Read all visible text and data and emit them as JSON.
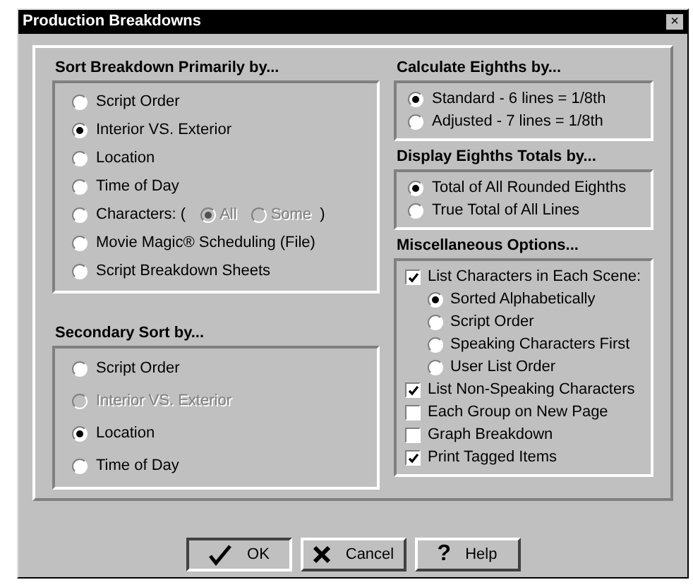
{
  "window": {
    "title": "Production Breakdowns",
    "close": "×"
  },
  "primary_sort": {
    "title": "Sort Breakdown Primarily by...",
    "options": [
      {
        "kind": "radio",
        "label": "Script Order",
        "selected": false,
        "disabled": false
      },
      {
        "kind": "radio",
        "label": "Interior VS. Exterior",
        "selected": true,
        "disabled": false
      },
      {
        "kind": "radio",
        "label": "Location",
        "selected": false,
        "disabled": false
      },
      {
        "kind": "radio",
        "label": "Time of Day",
        "selected": false,
        "disabled": false
      },
      {
        "kind": "characters",
        "label": "Characters: (",
        "selected": false,
        "suffix": ")",
        "options": [
          {
            "label": "All",
            "selected": true,
            "disabled": true
          },
          {
            "label": "Some",
            "selected": false,
            "disabled": true
          }
        ]
      },
      {
        "kind": "radio",
        "label": "Movie Magic® Scheduling (File)",
        "selected": false,
        "disabled": false
      },
      {
        "kind": "radio",
        "label": "Script Breakdown Sheets",
        "selected": false,
        "disabled": false
      }
    ]
  },
  "secondary_sort": {
    "title": "Secondary Sort by...",
    "options": [
      {
        "kind": "radio",
        "label": "Script Order",
        "selected": false,
        "disabled": false
      },
      {
        "kind": "radio",
        "label": "Interior VS. Exterior",
        "selected": false,
        "disabled": true
      },
      {
        "kind": "radio",
        "label": "Location",
        "selected": true,
        "disabled": false
      },
      {
        "kind": "radio",
        "label": "Time of Day",
        "selected": false,
        "disabled": false
      }
    ]
  },
  "calculate_eighths": {
    "title": "Calculate Eighths by...",
    "options": [
      {
        "label": "Standard - 6 lines = 1/8th",
        "selected": true
      },
      {
        "label": "Adjusted - 7 lines = 1/8th",
        "selected": false
      }
    ]
  },
  "display_eighths": {
    "title": "Display Eighths Totals by...",
    "options": [
      {
        "label": "Total of All Rounded Eighths",
        "selected": true
      },
      {
        "label": "True Total of All Lines",
        "selected": false
      }
    ]
  },
  "misc": {
    "title": "Miscellaneous Options...",
    "options": [
      {
        "label": "List Characters in Each Scene:",
        "checked": true,
        "children": [
          {
            "label": "Sorted Alphabetically",
            "selected": true
          },
          {
            "label": "Script Order",
            "selected": false
          },
          {
            "label": "Speaking Characters First",
            "selected": false
          },
          {
            "label": "User List Order",
            "selected": false
          }
        ]
      },
      {
        "label": "List Non-Speaking Characters",
        "checked": true
      },
      {
        "label": "Each Group on New Page",
        "checked": false
      },
      {
        "label": "Graph Breakdown",
        "checked": false
      },
      {
        "label": "Print Tagged Items",
        "checked": true
      }
    ]
  },
  "buttons": [
    {
      "kind": "ok",
      "label": "OK",
      "default": true
    },
    {
      "kind": "cancel",
      "label": "Cancel",
      "default": false
    },
    {
      "kind": "help",
      "label": "Help",
      "default": false,
      "icon": "?"
    }
  ]
}
